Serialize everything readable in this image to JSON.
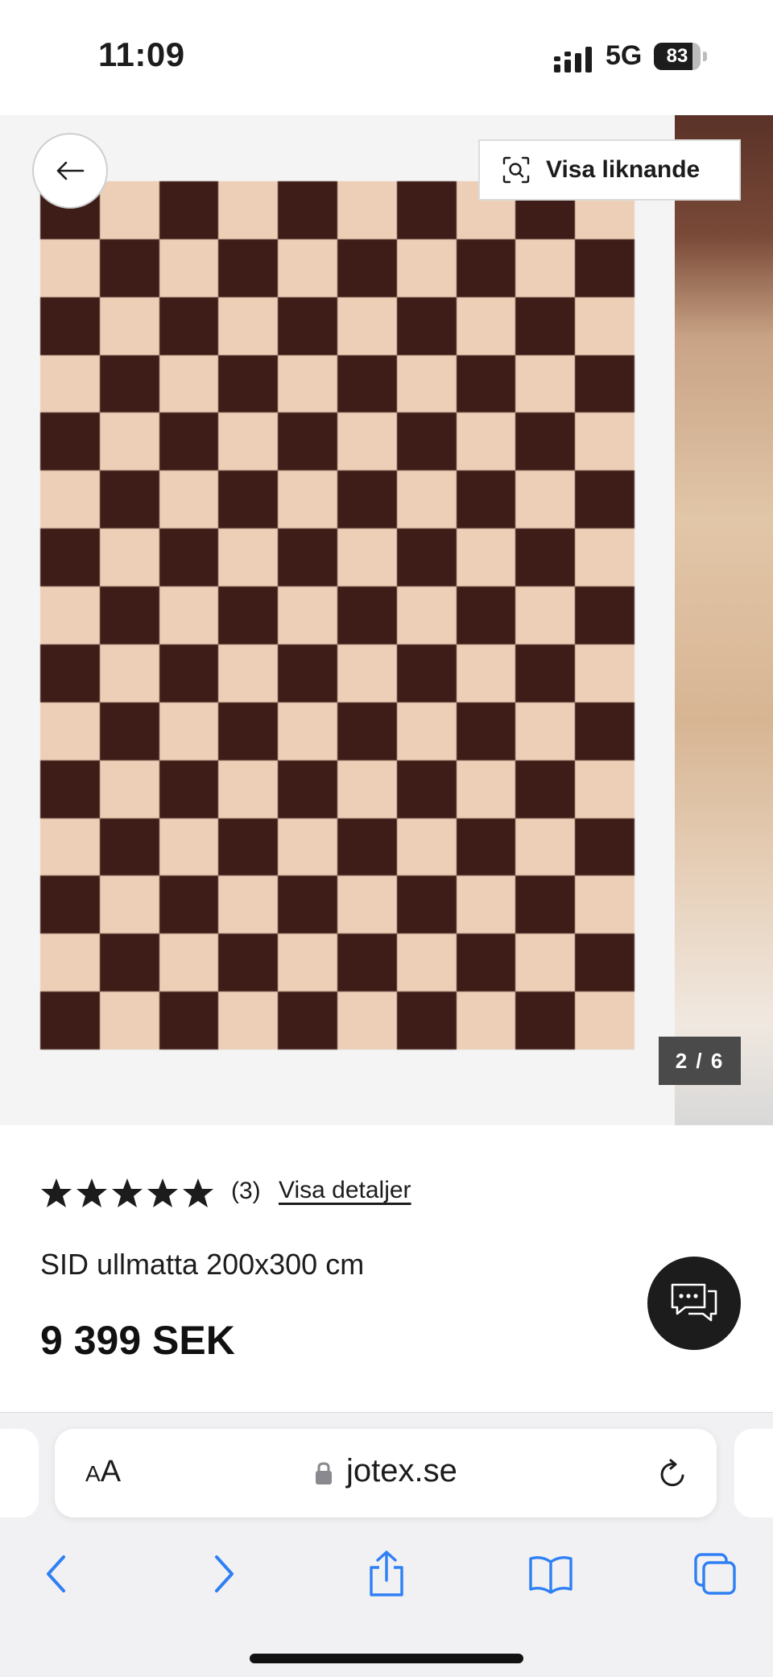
{
  "status_bar": {
    "time": "11:09",
    "network": "5G",
    "battery": "83",
    "battery_level": 0.83
  },
  "gallery": {
    "similar_label": "Visa liknande",
    "counter": "2 / 6",
    "rug_colors": {
      "dark": "#3e1d18",
      "light": "#eccfb6"
    }
  },
  "product": {
    "rating_stars": 5,
    "review_count": "(3)",
    "details_link": "Visa detaljer",
    "name": "SID ullmatta 200x300 cm",
    "price": "9 399 SEK"
  },
  "browser": {
    "aa_label_small": "A",
    "aa_label_large": "A",
    "url": "jotex.se"
  },
  "icons": {
    "back": "arrow-left-icon",
    "similar": "visual-search-icon",
    "chat": "chat-icon",
    "lock": "lock-icon",
    "reload": "reload-icon",
    "nav": [
      "chevron-left-icon",
      "chevron-right-icon",
      "share-icon",
      "book-icon",
      "tabs-icon"
    ]
  },
  "colors": {
    "accent": "#2f7ff5",
    "price_text": "#111111",
    "counter_bg": "#4a4a4a",
    "chat_bg": "#1c1c1c"
  }
}
